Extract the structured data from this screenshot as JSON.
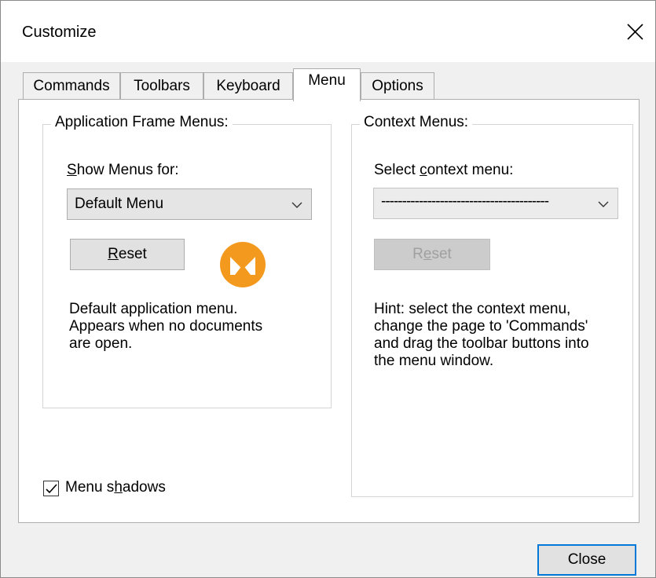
{
  "window": {
    "title": "Customize"
  },
  "tabs": [
    {
      "label": "Commands"
    },
    {
      "label": "Toolbars"
    },
    {
      "label": "Keyboard"
    },
    {
      "label": "Menu"
    },
    {
      "label": "Options"
    }
  ],
  "active_tab": "Menu",
  "app_frame_group": {
    "title": "Application Frame Menus:",
    "show_menus_label": "how Menus for:",
    "show_menus_label_underlined": "S",
    "combo_value": "Default Menu",
    "reset_label_rest": "eset",
    "reset_label_underlined": "R",
    "description": "Default application menu.\nAppears when no documents\nare open."
  },
  "context_group": {
    "title": "Context Menus:",
    "select_label_prefix": "Select ",
    "select_label_underlined": "c",
    "select_label_rest": "ontext menu:",
    "combo_value": "----------------------------------------",
    "reset_prefix": "R",
    "reset_underlined": "e",
    "reset_rest": "set",
    "hint": "Hint: select the context menu,\nchange the page to 'Commands'\nand drag the toolbar buttons into\nthe menu window."
  },
  "menu_shadows": {
    "prefix": "Menu s",
    "underlined": "h",
    "rest": "adows",
    "checked": true
  },
  "footer": {
    "close_label": "Close"
  },
  "colors": {
    "accent": "#0078d7",
    "logo": "#f39a1e"
  },
  "icons": [
    "close-icon",
    "chevron-down-icon",
    "app-logo-icon",
    "checkmark-icon"
  ]
}
